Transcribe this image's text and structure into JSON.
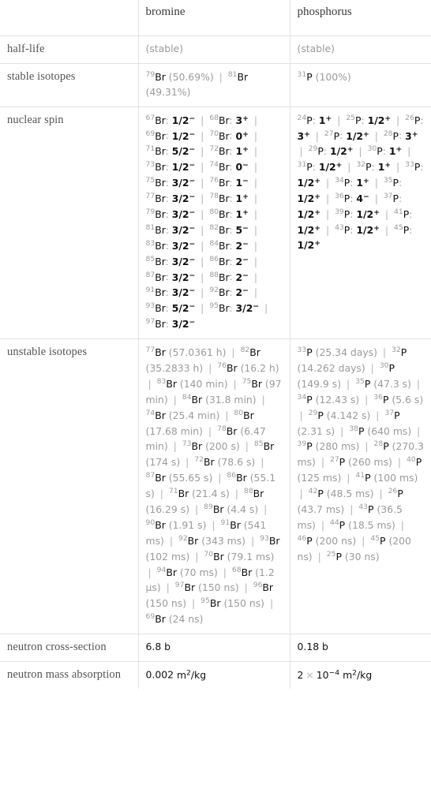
{
  "table": {
    "columns": [
      "",
      "bromine",
      "phosphorus"
    ],
    "header": {
      "blank": "",
      "bromine": "bromine",
      "phosphorus": "phosphorus"
    },
    "rows": [
      {
        "label": "half-life",
        "bromine": {
          "text": "(stable)",
          "style": "dim"
        },
        "phosphorus": {
          "text": "(stable)",
          "style": "dim"
        }
      },
      {
        "label": "stable isotopes",
        "bromine": {
          "items": [
            {
              "mass": "79",
              "element": "Br",
              "value": "(50.69%)"
            },
            {
              "mass": "81",
              "element": "Br",
              "value": "(49.31%)"
            }
          ]
        },
        "phosphorus": {
          "items": [
            {
              "mass": "31",
              "element": "P",
              "value": "(100%)"
            }
          ]
        }
      },
      {
        "label": "nuclear spin",
        "bromine": {
          "spins": [
            {
              "mass": "67",
              "element": "Br",
              "spin": "1/2",
              "sign": "-"
            },
            {
              "mass": "68",
              "element": "Br",
              "spin": "3",
              "sign": "+"
            },
            {
              "mass": "69",
              "element": "Br",
              "spin": "1/2",
              "sign": "-"
            },
            {
              "mass": "70",
              "element": "Br",
              "spin": "0",
              "sign": "+"
            },
            {
              "mass": "71",
              "element": "Br",
              "spin": "5/2",
              "sign": "-"
            },
            {
              "mass": "72",
              "element": "Br",
              "spin": "1",
              "sign": "+"
            },
            {
              "mass": "73",
              "element": "Br",
              "spin": "1/2",
              "sign": "-"
            },
            {
              "mass": "74",
              "element": "Br",
              "spin": "0",
              "sign": "-"
            },
            {
              "mass": "75",
              "element": "Br",
              "spin": "3/2",
              "sign": "-"
            },
            {
              "mass": "76",
              "element": "Br",
              "spin": "1",
              "sign": "-"
            },
            {
              "mass": "77",
              "element": "Br",
              "spin": "3/2",
              "sign": "-"
            },
            {
              "mass": "78",
              "element": "Br",
              "spin": "1",
              "sign": "+"
            },
            {
              "mass": "79",
              "element": "Br",
              "spin": "3/2",
              "sign": "-"
            },
            {
              "mass": "80",
              "element": "Br",
              "spin": "1",
              "sign": "+"
            },
            {
              "mass": "81",
              "element": "Br",
              "spin": "3/2",
              "sign": "-"
            },
            {
              "mass": "82",
              "element": "Br",
              "spin": "5",
              "sign": "-"
            },
            {
              "mass": "83",
              "element": "Br",
              "spin": "3/2",
              "sign": "-"
            },
            {
              "mass": "84",
              "element": "Br",
              "spin": "2",
              "sign": "-"
            },
            {
              "mass": "85",
              "element": "Br",
              "spin": "3/2",
              "sign": "-"
            },
            {
              "mass": "86",
              "element": "Br",
              "spin": "2",
              "sign": "-"
            },
            {
              "mass": "87",
              "element": "Br",
              "spin": "3/2",
              "sign": "-"
            },
            {
              "mass": "88",
              "element": "Br",
              "spin": "2",
              "sign": "-"
            },
            {
              "mass": "91",
              "element": "Br",
              "spin": "3/2",
              "sign": "-"
            },
            {
              "mass": "92",
              "element": "Br",
              "spin": "2",
              "sign": "-"
            },
            {
              "mass": "93",
              "element": "Br",
              "spin": "5/2",
              "sign": "-"
            },
            {
              "mass": "95",
              "element": "Br",
              "spin": "3/2",
              "sign": "-"
            },
            {
              "mass": "97",
              "element": "Br",
              "spin": "3/2",
              "sign": "-"
            }
          ]
        },
        "phosphorus": {
          "spins": [
            {
              "mass": "24",
              "element": "P",
              "spin": "1",
              "sign": "+"
            },
            {
              "mass": "25",
              "element": "P",
              "spin": "1/2",
              "sign": "+"
            },
            {
              "mass": "26",
              "element": "P",
              "spin": "3",
              "sign": "+"
            },
            {
              "mass": "27",
              "element": "P",
              "spin": "1/2",
              "sign": "+"
            },
            {
              "mass": "28",
              "element": "P",
              "spin": "3",
              "sign": "+"
            },
            {
              "mass": "29",
              "element": "P",
              "spin": "1/2",
              "sign": "+"
            },
            {
              "mass": "30",
              "element": "P",
              "spin": "1",
              "sign": "+"
            },
            {
              "mass": "31",
              "element": "P",
              "spin": "1/2",
              "sign": "+"
            },
            {
              "mass": "32",
              "element": "P",
              "spin": "1",
              "sign": "+"
            },
            {
              "mass": "33",
              "element": "P",
              "spin": "1/2",
              "sign": "+"
            },
            {
              "mass": "34",
              "element": "P",
              "spin": "1",
              "sign": "+"
            },
            {
              "mass": "35",
              "element": "P",
              "spin": "1/2",
              "sign": "+"
            },
            {
              "mass": "36",
              "element": "P",
              "spin": "4",
              "sign": "-"
            },
            {
              "mass": "37",
              "element": "P",
              "spin": "1/2",
              "sign": "+"
            },
            {
              "mass": "39",
              "element": "P",
              "spin": "1/2",
              "sign": "+"
            },
            {
              "mass": "41",
              "element": "P",
              "spin": "1/2",
              "sign": "+"
            },
            {
              "mass": "43",
              "element": "P",
              "spin": "1/2",
              "sign": "+"
            },
            {
              "mass": "45",
              "element": "P",
              "spin": "1/2",
              "sign": "+"
            }
          ]
        }
      },
      {
        "label": "unstable isotopes",
        "bromine": {
          "items": [
            {
              "mass": "77",
              "element": "Br",
              "value": "(57.0361 h)"
            },
            {
              "mass": "82",
              "element": "Br",
              "value": "(35.2833 h)"
            },
            {
              "mass": "76",
              "element": "Br",
              "value": "(16.2 h)"
            },
            {
              "mass": "83",
              "element": "Br",
              "value": "(140 min)"
            },
            {
              "mass": "75",
              "element": "Br",
              "value": "(97 min)"
            },
            {
              "mass": "84",
              "element": "Br",
              "value": "(31.8 min)"
            },
            {
              "mass": "74",
              "element": "Br",
              "value": "(25.4 min)"
            },
            {
              "mass": "80",
              "element": "Br",
              "value": "(17.68 min)"
            },
            {
              "mass": "78",
              "element": "Br",
              "value": "(6.47 min)"
            },
            {
              "mass": "73",
              "element": "Br",
              "value": "(200 s)"
            },
            {
              "mass": "85",
              "element": "Br",
              "value": "(174 s)"
            },
            {
              "mass": "72",
              "element": "Br",
              "value": "(78.6 s)"
            },
            {
              "mass": "87",
              "element": "Br",
              "value": "(55.65 s)"
            },
            {
              "mass": "86",
              "element": "Br",
              "value": "(55.1 s)"
            },
            {
              "mass": "71",
              "element": "Br",
              "value": "(21.4 s)"
            },
            {
              "mass": "88",
              "element": "Br",
              "value": "(16.29 s)"
            },
            {
              "mass": "89",
              "element": "Br",
              "value": "(4.4 s)"
            },
            {
              "mass": "90",
              "element": "Br",
              "value": "(1.91 s)"
            },
            {
              "mass": "91",
              "element": "Br",
              "value": "(541 ms)"
            },
            {
              "mass": "92",
              "element": "Br",
              "value": "(343 ms)"
            },
            {
              "mass": "93",
              "element": "Br",
              "value": "(102 ms)"
            },
            {
              "mass": "70",
              "element": "Br",
              "value": "(79.1 ms)"
            },
            {
              "mass": "94",
              "element": "Br",
              "value": "(70 ms)"
            },
            {
              "mass": "68",
              "element": "Br",
              "value": "(1.2 µs)"
            },
            {
              "mass": "97",
              "element": "Br",
              "value": "(150 ns)"
            },
            {
              "mass": "96",
              "element": "Br",
              "value": "(150 ns)"
            },
            {
              "mass": "95",
              "element": "Br",
              "value": "(150 ns)"
            },
            {
              "mass": "69",
              "element": "Br",
              "value": "(24 ns)"
            }
          ]
        },
        "phosphorus": {
          "items": [
            {
              "mass": "33",
              "element": "P",
              "value": "(25.34 days)"
            },
            {
              "mass": "32",
              "element": "P",
              "value": "(14.262 days)"
            },
            {
              "mass": "30",
              "element": "P",
              "value": "(149.9 s)"
            },
            {
              "mass": "35",
              "element": "P",
              "value": "(47.3 s)"
            },
            {
              "mass": "34",
              "element": "P",
              "value": "(12.43 s)"
            },
            {
              "mass": "36",
              "element": "P",
              "value": "(5.6 s)"
            },
            {
              "mass": "29",
              "element": "P",
              "value": "(4.142 s)"
            },
            {
              "mass": "37",
              "element": "P",
              "value": "(2.31 s)"
            },
            {
              "mass": "38",
              "element": "P",
              "value": "(640 ms)"
            },
            {
              "mass": "39",
              "element": "P",
              "value": "(280 ms)"
            },
            {
              "mass": "28",
              "element": "P",
              "value": "(270.3 ms)"
            },
            {
              "mass": "27",
              "element": "P",
              "value": "(260 ms)"
            },
            {
              "mass": "40",
              "element": "P",
              "value": "(125 ms)"
            },
            {
              "mass": "41",
              "element": "P",
              "value": "(100 ms)"
            },
            {
              "mass": "42",
              "element": "P",
              "value": "(48.5 ms)"
            },
            {
              "mass": "26",
              "element": "P",
              "value": "(43.7 ms)"
            },
            {
              "mass": "43",
              "element": "P",
              "value": "(36.5 ms)"
            },
            {
              "mass": "44",
              "element": "P",
              "value": "(18.5 ms)"
            },
            {
              "mass": "46",
              "element": "P",
              "value": "(200 ns)"
            },
            {
              "mass": "45",
              "element": "P",
              "value": "(200 ns)"
            },
            {
              "mass": "25",
              "element": "P",
              "value": "(30 ns)"
            }
          ]
        }
      },
      {
        "label": "neutron cross-section",
        "bromine": {
          "text": "6.8 b"
        },
        "phosphorus": {
          "text": "0.18 b"
        }
      },
      {
        "label": "neutron mass absorption",
        "bromine": {
          "sci": {
            "mantissa": "0.002",
            "unit_base": "m",
            "unit_exp": "2",
            "unit_tail": "/kg"
          }
        },
        "phosphorus": {
          "sci": {
            "mantissa": "2",
            "times": "×",
            "base": "10",
            "exp": "-4",
            "unit_base": "m",
            "unit_exp": "2",
            "unit_tail": "/kg"
          }
        }
      }
    ]
  }
}
